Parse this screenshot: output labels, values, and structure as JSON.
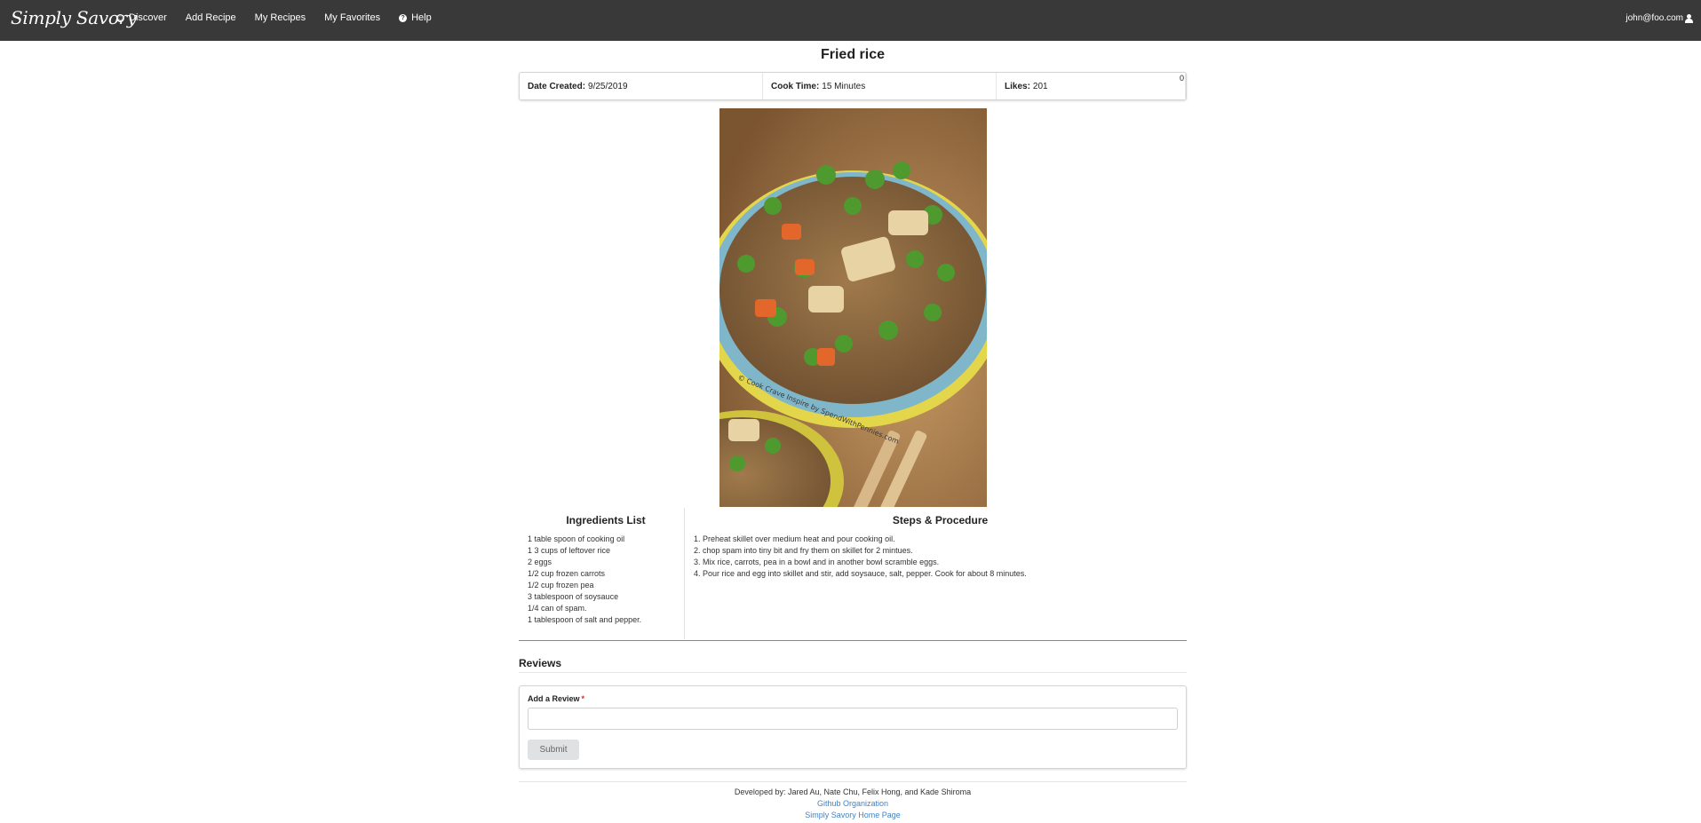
{
  "navbar": {
    "brand": "Simply Savory",
    "items": [
      {
        "label": "Discover",
        "icon": "compass-icon",
        "glyph": "◉"
      },
      {
        "label": "Add Recipe",
        "icon": "",
        "glyph": ""
      },
      {
        "label": "My Recipes",
        "icon": "",
        "glyph": ""
      },
      {
        "label": "My Favorites",
        "icon": "",
        "glyph": ""
      },
      {
        "label": "Help",
        "icon": "question-circle-icon",
        "glyph": "?"
      }
    ],
    "user_email": "john@foo.com",
    "user_icon": "user-icon"
  },
  "recipe": {
    "title": "Fried rice",
    "date_label": "Date Created:",
    "date_value": "9/25/2019",
    "cook_label": "Cook Time:",
    "cook_value": "15 Minutes",
    "likes_label": "Likes:",
    "likes_value": "201",
    "corner_count": "0",
    "image_watermark": "© Cook Crave Inspire by SpendWithPennies.com"
  },
  "ingredients": {
    "title": "Ingredients List",
    "items": [
      "1 table spoon of cooking oil",
      "1 3 cups of leftover rice",
      "2 eggs",
      "1/2 cup frozen carrots",
      "1/2 cup frozen pea",
      "3 tablespoon of soysauce",
      "1/4 can of spam.",
      "1 tablespoon of salt and pepper."
    ]
  },
  "steps": {
    "title": "Steps & Procedure",
    "items": [
      "1. Preheat skillet over medium heat and pour cooking oil.",
      "2. chop spam into tiny bit and fry them on skillet for 2 mintues.",
      "3. Mix rice, carrots, pea in a bowl and in another bowl scramble eggs.",
      "4. Pour rice and egg into skillet and stir, add soysauce, salt, pepper. Cook for about 8 minutes."
    ]
  },
  "reviews": {
    "title": "Reviews",
    "add_label": "Add a Review",
    "required_mark": "*",
    "input_value": "",
    "submit_label": "Submit"
  },
  "footer": {
    "developers": "Developed by: Jared Au, Nate Chu, Felix Hong, and Kade Shiroma",
    "github_link": "Github Organization",
    "home_link": "Simply Savory Home Page"
  },
  "colors": {
    "navbar_bg": "#393939",
    "link": "#4183c4",
    "required": "#db2828",
    "button_bg": "#e0e1e2"
  }
}
